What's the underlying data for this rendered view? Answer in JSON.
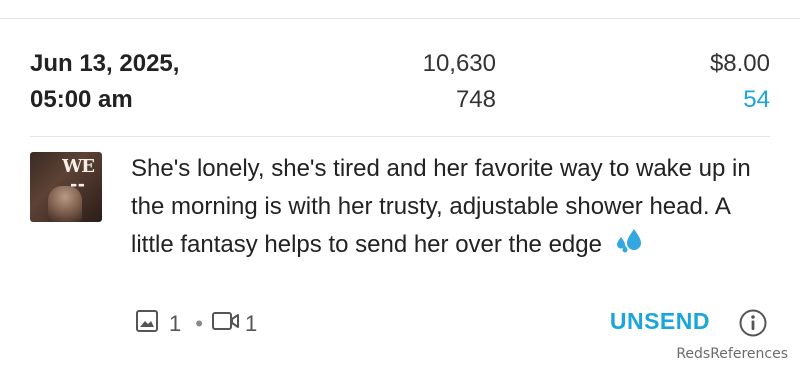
{
  "stats": {
    "date_line1": "Jun 13, 2025,",
    "date_line2": "05:00 am",
    "count_primary": "10,630",
    "count_secondary": "748",
    "price": "$8.00",
    "purchases": "54"
  },
  "post": {
    "thumbnail_logo": "WE",
    "message": "She's lonely, she's tired and her favorite way to wake up in the morning is with her trusty, adjustable shower head. A little fantasy helps to send her over the edge",
    "emoji": "sweat-droplets-icon"
  },
  "attachments": {
    "images_count": "1",
    "separator": "•",
    "videos_count": "1"
  },
  "actions": {
    "unsend_label": "UNSEND",
    "info_icon": "info-icon"
  },
  "watermark": "RedsReferences",
  "colors": {
    "accent": "#1aa6dd",
    "text": "#222222",
    "divider": "#e6e6e6"
  }
}
